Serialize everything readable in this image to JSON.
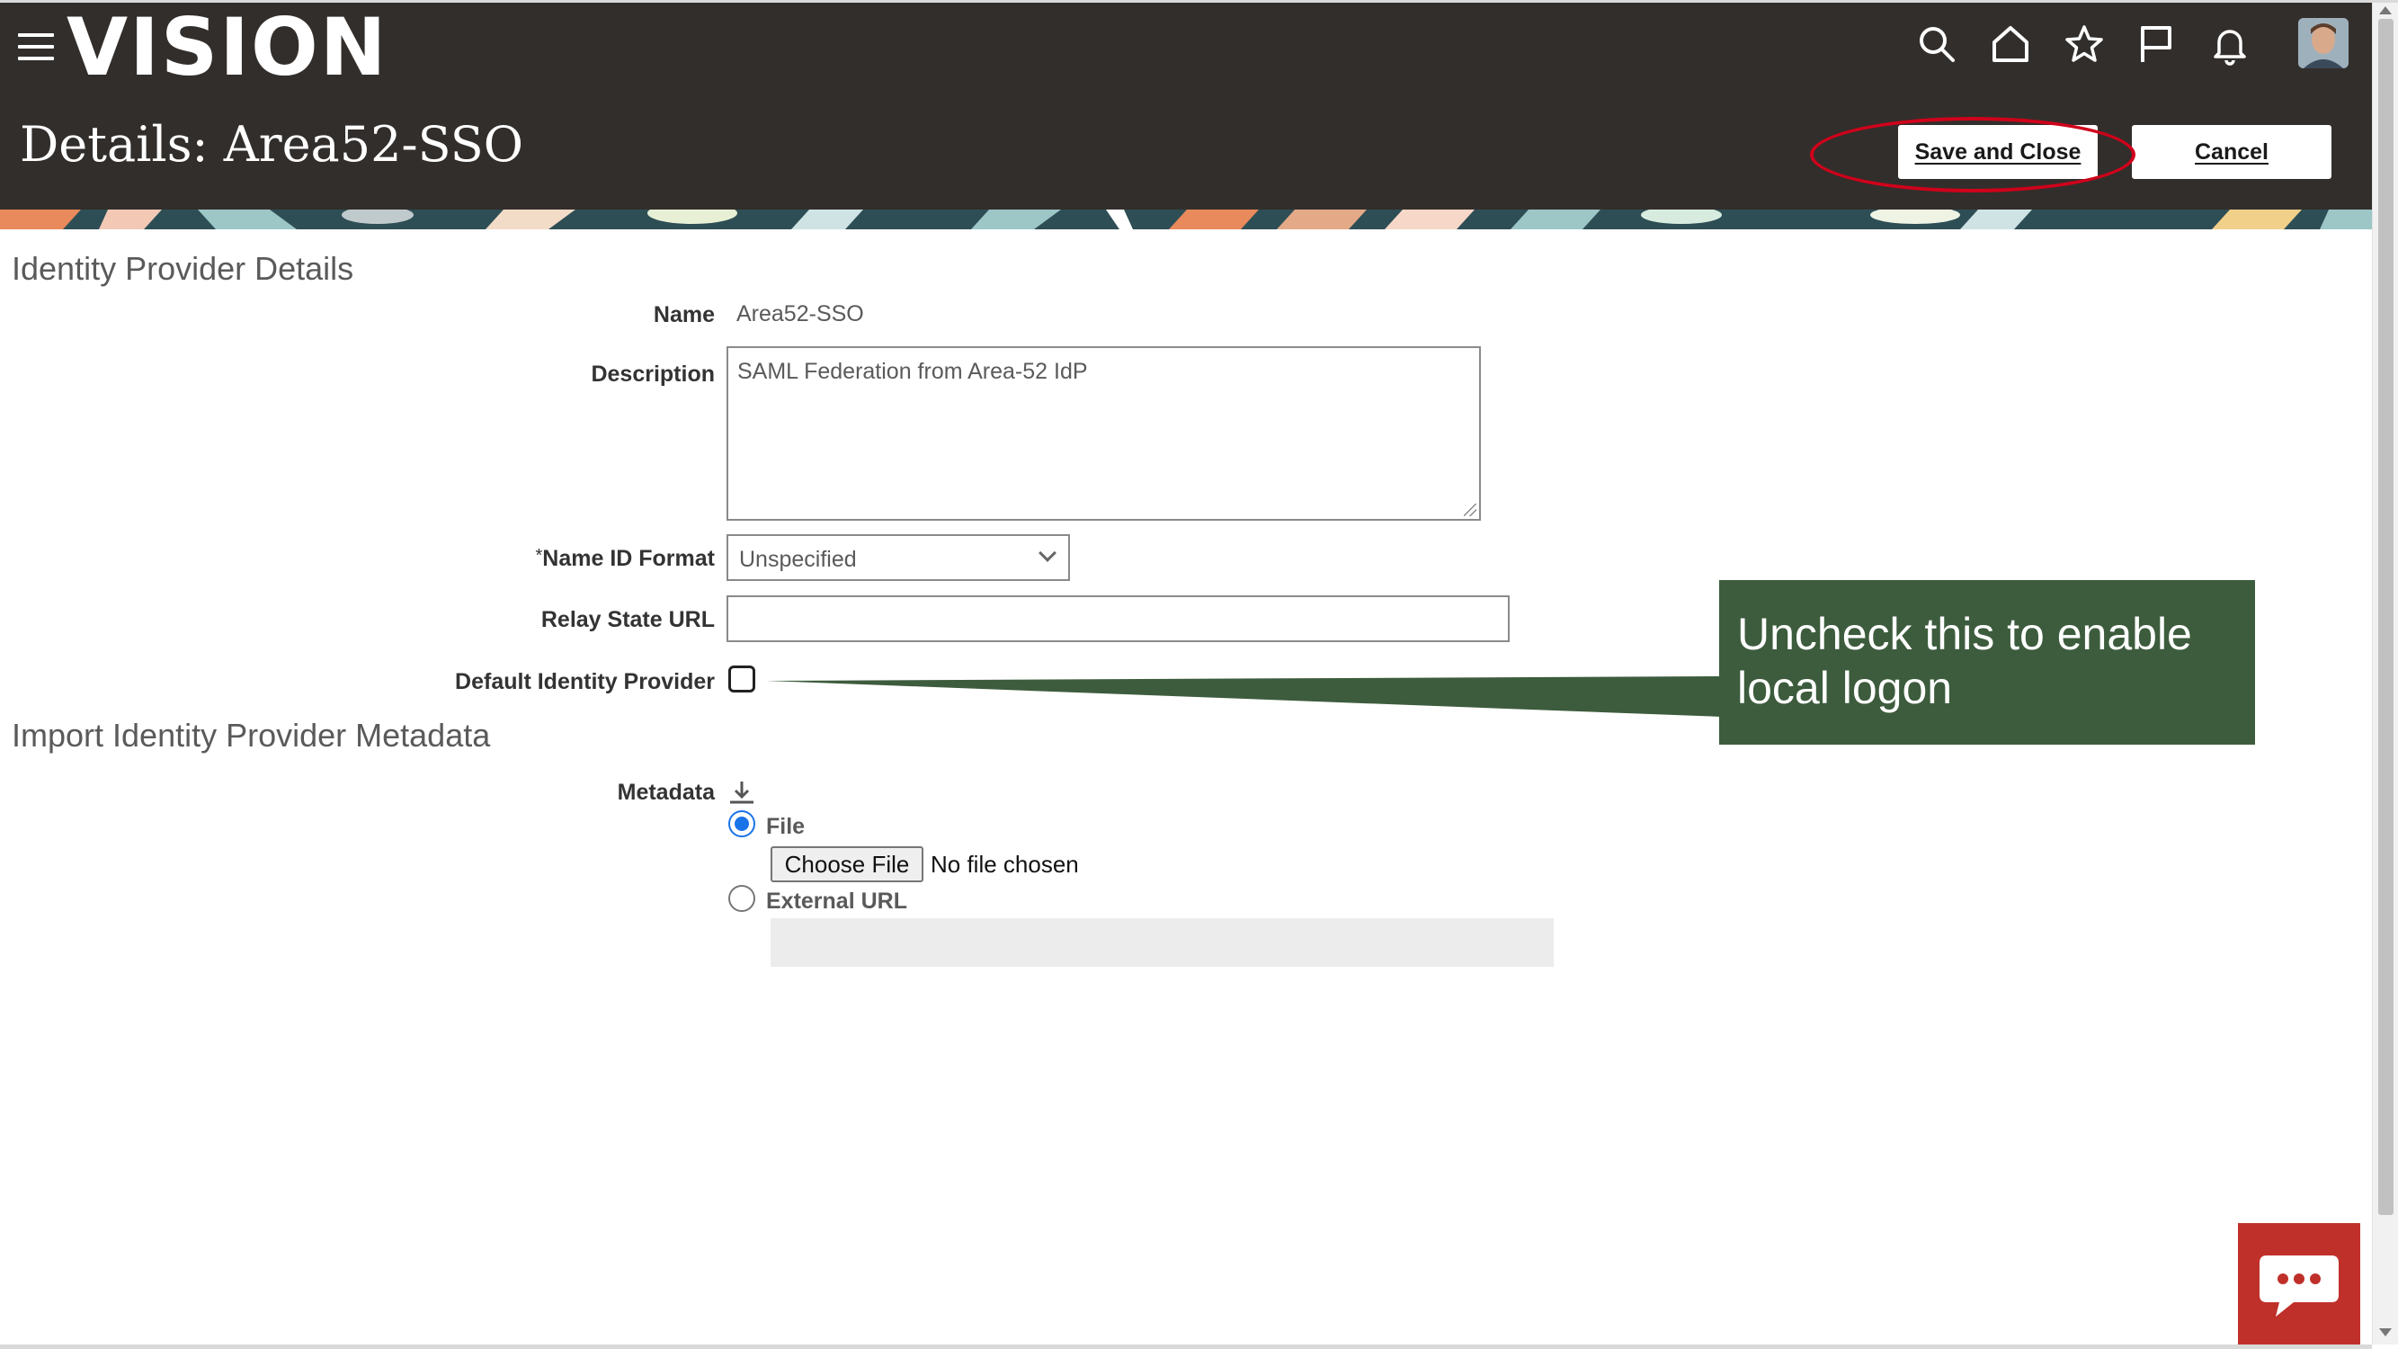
{
  "header": {
    "logo": "VISION",
    "page_title": "Details: Area52-SSO",
    "icons": [
      "search-icon",
      "home-icon",
      "star-icon",
      "flag-icon",
      "bell-icon"
    ],
    "save_close_label": "Save and Close",
    "cancel_label": "Cancel"
  },
  "identity_provider": {
    "section_title": "Identity Provider Details",
    "name_label": "Name",
    "name_value": "Area52-SSO",
    "description_label": "Description",
    "description_value": "SAML Federation from Area-52 IdP",
    "name_id_format_required": "*",
    "name_id_format_label": "Name ID Format",
    "name_id_format_value": "Unspecified",
    "relay_state_label": "Relay State URL",
    "relay_state_value": "",
    "default_idp_label": "Default Identity Provider",
    "default_idp_checked": false
  },
  "callout": {
    "text": "Uncheck this to enable local logon",
    "color": "#3d5c3d"
  },
  "metadata": {
    "section_title": "Import Identity Provider Metadata",
    "label": "Metadata",
    "file_option": "File",
    "choose_file_label": "Choose File",
    "no_file_text": "No file chosen",
    "external_url_option": "External URL",
    "selected": "File"
  },
  "colors": {
    "header_bg": "#322e2b",
    "highlight": "#d0021b",
    "chat_bg": "#c0302b"
  }
}
